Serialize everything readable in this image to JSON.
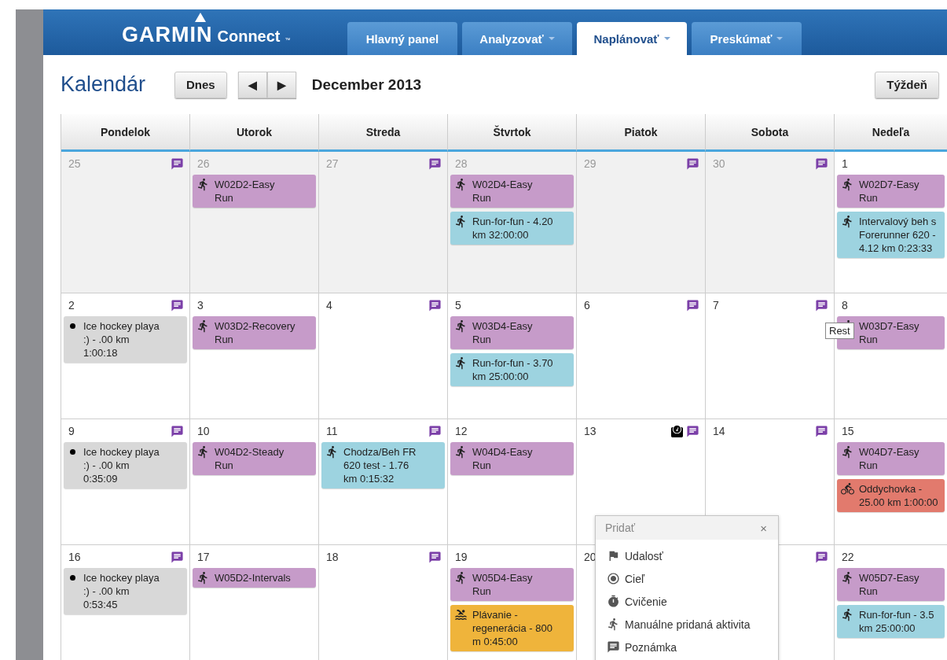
{
  "brand": {
    "name": "GARMIN",
    "product": "Connect",
    "mark": "™"
  },
  "nav": [
    {
      "label": "Hlavný panel",
      "has_menu": false,
      "selected": false
    },
    {
      "label": "Analyzovať",
      "has_menu": true,
      "selected": false
    },
    {
      "label": "Naplánovať",
      "has_menu": true,
      "selected": true
    },
    {
      "label": "Preskúmať",
      "has_menu": true,
      "selected": false
    }
  ],
  "toolbar": {
    "title": "Kalendár",
    "today": "Dnes",
    "prev": "◀",
    "next": "▶",
    "period": "December 2013",
    "view": "Týždeň"
  },
  "weekdays": [
    "Pondelok",
    "Utorok",
    "Streda",
    "Štvrtok",
    "Piatok",
    "Sobota",
    "Nedeľa"
  ],
  "weeks": [
    [
      {
        "day": "25",
        "outside": true,
        "note": true
      },
      {
        "day": "26",
        "outside": true,
        "note": false,
        "events": [
          {
            "kind": "plan",
            "text": "W02D2-Easy\nRun"
          }
        ]
      },
      {
        "day": "27",
        "outside": true,
        "note": true
      },
      {
        "day": "28",
        "outside": true,
        "note": false,
        "events": [
          {
            "kind": "plan",
            "text": "W02D4-Easy\nRun"
          },
          {
            "kind": "run",
            "text": "Run-for-fun - 4.20\nkm 32:00:00"
          }
        ]
      },
      {
        "day": "29",
        "outside": true,
        "note": true
      },
      {
        "day": "30",
        "outside": true,
        "note": true
      },
      {
        "day": "1",
        "outside": false,
        "note": false,
        "events": [
          {
            "kind": "plan",
            "text": "W02D7-Easy\nRun"
          },
          {
            "kind": "run",
            "text": "Intervalový beh s\nForerunner 620 -\n4.12 km 0:23:33"
          }
        ]
      }
    ],
    [
      {
        "day": "2",
        "outside": false,
        "note": true,
        "events": [
          {
            "kind": "other",
            "text": "Ice hockey playa\n:) - .00 km\n1:00:18"
          }
        ]
      },
      {
        "day": "3",
        "outside": false,
        "note": false,
        "events": [
          {
            "kind": "plan",
            "text": "W03D2-Recovery\nRun"
          }
        ]
      },
      {
        "day": "4",
        "outside": false,
        "note": true
      },
      {
        "day": "5",
        "outside": false,
        "note": false,
        "events": [
          {
            "kind": "plan",
            "text": "W03D4-Easy\nRun"
          },
          {
            "kind": "run",
            "text": "Run-for-fun - 3.70\nkm 25:00:00"
          }
        ]
      },
      {
        "day": "6",
        "outside": false,
        "note": true
      },
      {
        "day": "7",
        "outside": false,
        "note": true
      },
      {
        "day": "8",
        "outside": false,
        "note": false,
        "tooltip": "Rest",
        "events": [
          {
            "kind": "plan",
            "text": "W03D7-Easy\nRun"
          }
        ]
      }
    ],
    [
      {
        "day": "9",
        "outside": false,
        "note": true,
        "events": [
          {
            "kind": "other",
            "text": "Ice hockey playa\n:) - .00 km\n0:35:09"
          }
        ]
      },
      {
        "day": "10",
        "outside": false,
        "note": false,
        "events": [
          {
            "kind": "plan",
            "text": "W04D2-Steady\nRun"
          }
        ]
      },
      {
        "day": "11",
        "outside": false,
        "note": true,
        "events": [
          {
            "kind": "run",
            "text": "Chodza/Beh FR\n620 test - 1.76\nkm 0:15:32"
          }
        ]
      },
      {
        "day": "12",
        "outside": false,
        "note": false,
        "events": [
          {
            "kind": "plan",
            "text": "W04D4-Easy\nRun"
          }
        ]
      },
      {
        "day": "13",
        "outside": false,
        "note": true,
        "weight": true
      },
      {
        "day": "14",
        "outside": false,
        "note": true
      },
      {
        "day": "15",
        "outside": false,
        "note": false,
        "events": [
          {
            "kind": "plan",
            "text": "W04D7-Easy\nRun"
          },
          {
            "kind": "bike",
            "text": "Oddychovka -\n25.00 km 1:00:00"
          }
        ]
      }
    ],
    [
      {
        "day": "16",
        "outside": false,
        "note": true,
        "events": [
          {
            "kind": "other",
            "text": "Ice hockey playa\n:) - .00 km\n0:53:45"
          }
        ]
      },
      {
        "day": "17",
        "outside": false,
        "note": false,
        "events": [
          {
            "kind": "plan",
            "text": "W05D2-Intervals"
          }
        ]
      },
      {
        "day": "18",
        "outside": false,
        "note": true
      },
      {
        "day": "19",
        "outside": false,
        "note": false,
        "events": [
          {
            "kind": "plan",
            "text": "W05D4-Easy\nRun"
          },
          {
            "kind": "swim",
            "text": "Plávanie -\nregenerácia - 800\nm 0:45:00"
          }
        ]
      },
      {
        "day": "20",
        "outside": false,
        "note": false
      },
      {
        "outside": false,
        "note": true
      },
      {
        "day": "22",
        "outside": false,
        "note": false,
        "events": [
          {
            "kind": "plan",
            "text": "W05D7-Easy\nRun"
          },
          {
            "kind": "run",
            "text": "Run-for-fun - 3.5\nkm 25:00:00"
          }
        ]
      }
    ]
  ],
  "add_popup": {
    "title": "Pridať",
    "close": "×",
    "items": [
      {
        "kind": "event",
        "label": "Udalosť"
      },
      {
        "kind": "goal",
        "label": "Cieľ"
      },
      {
        "kind": "workout",
        "label": "Cvičenie"
      },
      {
        "kind": "activity",
        "label": "Manuálne pridaná aktivita"
      },
      {
        "kind": "note",
        "label": "Poznámka"
      }
    ]
  }
}
